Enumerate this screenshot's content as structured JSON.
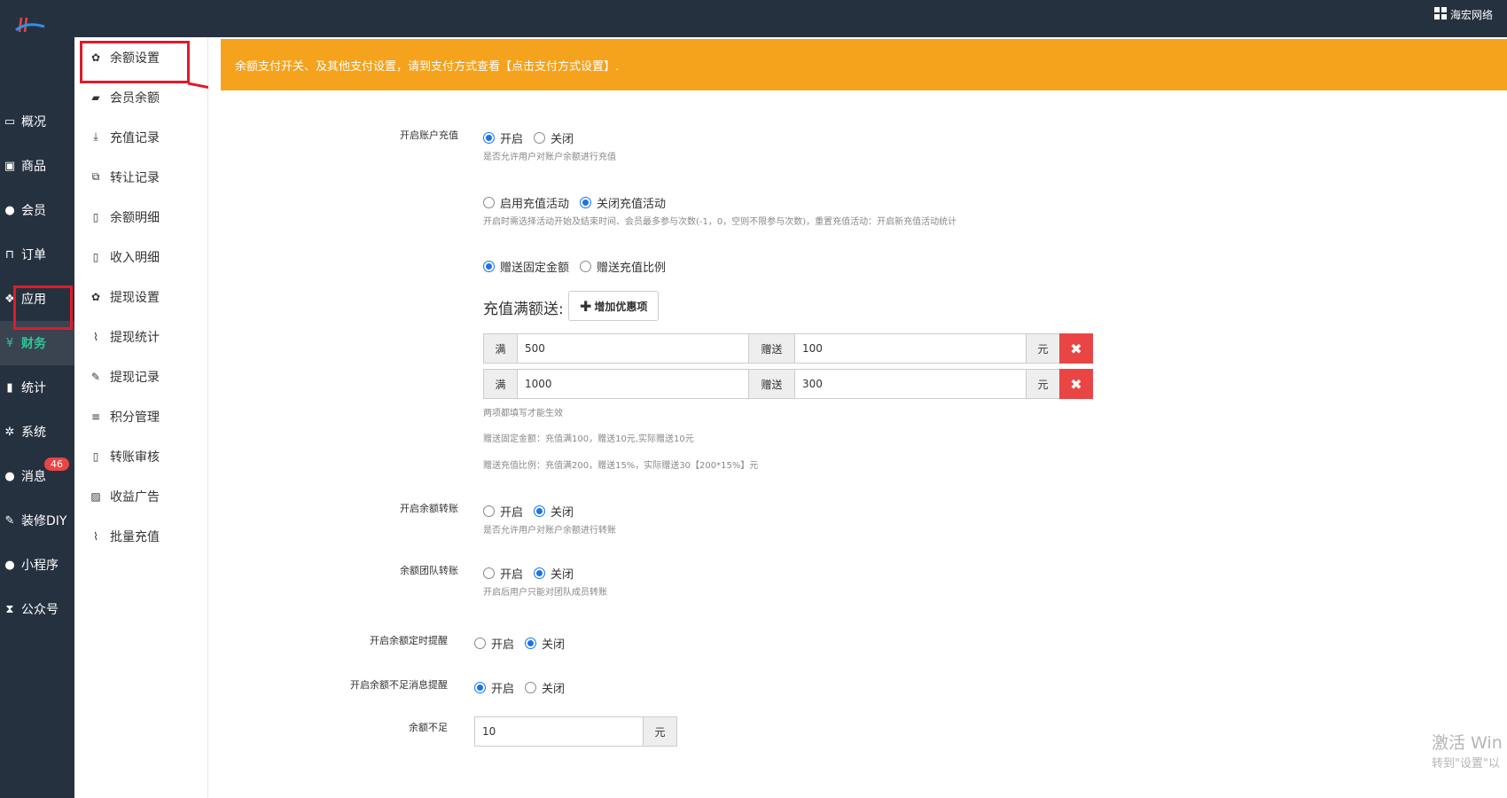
{
  "header": {
    "brand": "海宏网络",
    "brand_icon": "grid-icon"
  },
  "mainnav": [
    {
      "label": "概况",
      "icon": "monitor-icon"
    },
    {
      "label": "商品",
      "icon": "box-icon"
    },
    {
      "label": "会员",
      "icon": "users-icon"
    },
    {
      "label": "订单",
      "icon": "cart-icon"
    },
    {
      "label": "应用",
      "icon": "cubes-icon"
    },
    {
      "label": "财务",
      "icon": "yen-icon"
    },
    {
      "label": "统计",
      "icon": "bar-chart-icon"
    },
    {
      "label": "系统",
      "icon": "gears-icon"
    },
    {
      "label": "消息",
      "icon": "comment-icon",
      "badge": "46"
    },
    {
      "label": "装修DIY",
      "icon": "gavel-icon"
    },
    {
      "label": "小程序",
      "icon": "wechat-icon"
    },
    {
      "label": "公众号",
      "icon": "hourglass-icon"
    }
  ],
  "subnav": [
    {
      "label": "余额设置",
      "icon": "gear-icon"
    },
    {
      "label": "会员余额",
      "icon": "book-icon"
    },
    {
      "label": "充值记录",
      "icon": "download-icon"
    },
    {
      "label": "转让记录",
      "icon": "external-link-icon"
    },
    {
      "label": "余额明细",
      "icon": "file-icon"
    },
    {
      "label": "收入明细",
      "icon": "file-icon"
    },
    {
      "label": "提现设置",
      "icon": "gear-icon"
    },
    {
      "label": "提现统计",
      "icon": "line-chart-icon"
    },
    {
      "label": "提现记录",
      "icon": "pencil-icon"
    },
    {
      "label": "积分管理",
      "icon": "database-icon"
    },
    {
      "label": "转账审核",
      "icon": "file-icon"
    },
    {
      "label": "收益广告",
      "icon": "image-icon"
    },
    {
      "label": "批量充值",
      "icon": "line-chart-icon"
    }
  ],
  "alert": {
    "text": "余额支付开关、及其他支付设置，请到支付方式查看【点击支付方式设置】."
  },
  "form": {
    "recharge": {
      "label": "开启账户充值",
      "on": "开启",
      "off": "关闭",
      "help": "是否允许用户对账户余额进行充值"
    },
    "activity": {
      "opt1": "启用充值活动",
      "opt2": "关闭充值活动",
      "help": "开启时需选择活动开始及结束时间、会员最多参与次数(-1，0，空则不限参与次数)，重置充值活动：开启新充值活动统计"
    },
    "gift_type": {
      "opt1": "赠送固定金额",
      "opt2": "赠送充值比例"
    },
    "rules_title": "充值满额送:",
    "add_rule": "增加优惠项",
    "rules": [
      {
        "full_label": "满",
        "full": "500",
        "gift_label": "赠送",
        "gift": "100",
        "unit": "元"
      },
      {
        "full_label": "满",
        "full": "1000",
        "gift_label": "赠送",
        "gift": "300",
        "unit": "元"
      }
    ],
    "rules_help1": "两项都填写才能生效",
    "rules_help2": "赠送固定金额：充值满100，赠送10元,实际赠送10元",
    "rules_help3": "赠送充值比例：充值满200，赠送15%，实际赠送30【200*15%】元",
    "transfer": {
      "label": "开启余额转账",
      "on": "开启",
      "off": "关闭",
      "help": "是否允许用户对账户余额进行转账"
    },
    "team": {
      "label": "余额团队转账",
      "on": "开启",
      "off": "关闭",
      "help": "开启后用户只能对团队成员转账"
    },
    "timed": {
      "label": "开启余额定时提醒",
      "on": "开启",
      "off": "关闭"
    },
    "lack": {
      "label": "开启余额不足消息提醒",
      "on": "开启",
      "off": "关闭"
    },
    "low": {
      "label": "余额不足",
      "value": "10",
      "unit": "元"
    }
  },
  "watermark": {
    "line1": "激活 Win",
    "line2": "转到\"设置\"以"
  },
  "colors": {
    "sidebar": "#263140",
    "alert": "#f5a21d",
    "accent": "#1a73e8",
    "danger": "#e94545",
    "active_nav": "#2fc596",
    "highlight": "#e11a2a"
  }
}
